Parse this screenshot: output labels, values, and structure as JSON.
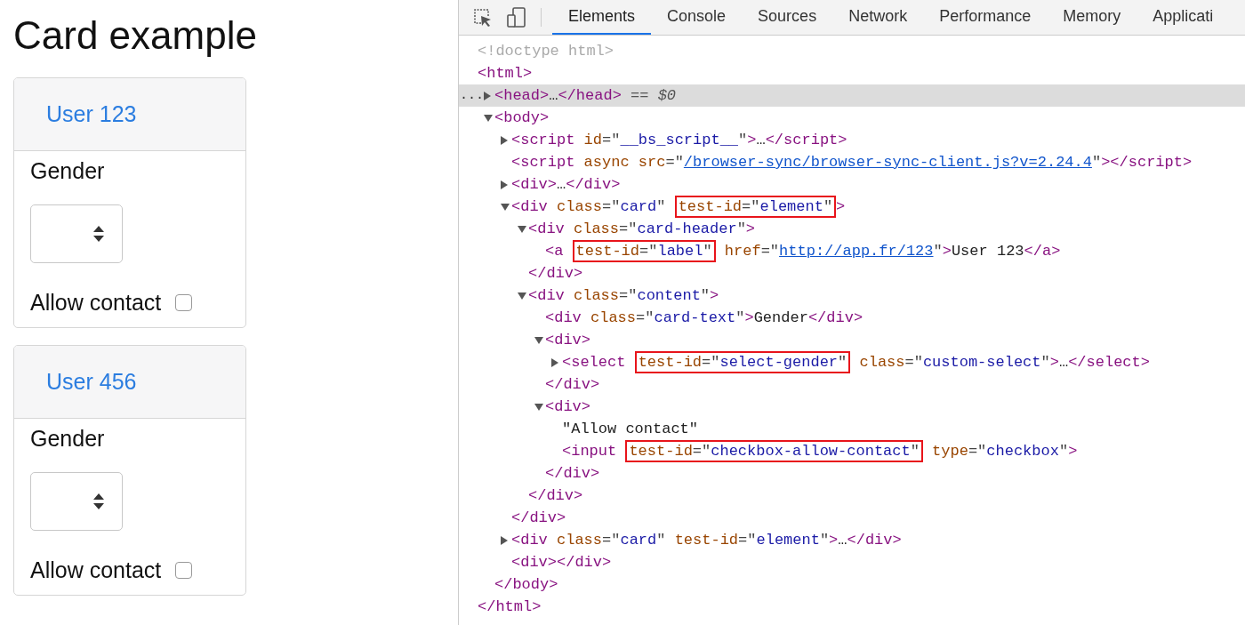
{
  "page": {
    "title": "Card example",
    "cards": [
      {
        "label": "User 123",
        "field_label": "Gender",
        "checkbox_label": "Allow contact",
        "checked": false
      },
      {
        "label": "User 456",
        "field_label": "Gender",
        "checkbox_label": "Allow contact",
        "checked": false
      }
    ]
  },
  "devtools": {
    "tabs": [
      {
        "label": "Elements",
        "selected": true
      },
      {
        "label": "Console",
        "selected": false
      },
      {
        "label": "Sources",
        "selected": false
      },
      {
        "label": "Network",
        "selected": false
      },
      {
        "label": "Performance",
        "selected": false
      },
      {
        "label": "Memory",
        "selected": false
      },
      {
        "label": "Applicati",
        "selected": false
      }
    ],
    "tree": [
      {
        "selected": false,
        "tokens": [
          {
            "kind": "comment",
            "text": "<!doctype html>"
          }
        ]
      },
      {
        "selected": false,
        "tokens": [
          {
            "kind": "tag",
            "text": "<html>"
          }
        ],
        "close": [
          {
            "kind": "tag",
            "text": "</html>"
          }
        ],
        "children": [
          {
            "expanded": false,
            "selected": true,
            "marker": "...",
            "tokens": [
              {
                "kind": "tag",
                "text": "<head>"
              },
              {
                "kind": "text",
                "text": "…"
              },
              {
                "kind": "tag",
                "text": "</head>"
              },
              {
                "kind": "dim",
                "text": " == "
              },
              {
                "kind": "var",
                "text": "$0"
              }
            ]
          },
          {
            "expanded": true,
            "selected": false,
            "tokens": [
              {
                "kind": "tag",
                "text": "<body>"
              }
            ],
            "close": [
              {
                "kind": "tag",
                "text": "</body>"
              }
            ],
            "children": [
              {
                "expanded": false,
                "selected": false,
                "tokens": [
                  {
                    "kind": "tag",
                    "text": "<script"
                  },
                  {
                    "kind": "attr",
                    "text": " id"
                  },
                  {
                    "kind": "punct",
                    "text": "=\""
                  },
                  {
                    "kind": "value",
                    "text": "__bs_script__"
                  },
                  {
                    "kind": "punct",
                    "text": "\""
                  },
                  {
                    "kind": "tag",
                    "text": ">"
                  },
                  {
                    "kind": "text",
                    "text": "…"
                  },
                  {
                    "kind": "tag",
                    "text": "</script>"
                  }
                ]
              },
              {
                "selected": false,
                "tokens": [
                  {
                    "kind": "tag",
                    "text": "<script"
                  },
                  {
                    "kind": "attr",
                    "text": " async src"
                  },
                  {
                    "kind": "punct",
                    "text": "=\""
                  },
                  {
                    "kind": "link",
                    "text": "/browser-sync/browser-sync-client.js?v=2.24.4"
                  },
                  {
                    "kind": "punct",
                    "text": "\""
                  },
                  {
                    "kind": "tag",
                    "text": "></script>"
                  }
                ]
              },
              {
                "expanded": false,
                "selected": false,
                "tokens": [
                  {
                    "kind": "tag",
                    "text": "<div>"
                  },
                  {
                    "kind": "text",
                    "text": "…"
                  },
                  {
                    "kind": "tag",
                    "text": "</div>"
                  }
                ]
              },
              {
                "expanded": true,
                "selected": false,
                "tokens": [
                  {
                    "kind": "tag",
                    "text": "<div"
                  },
                  {
                    "kind": "attr",
                    "text": " class"
                  },
                  {
                    "kind": "punct",
                    "text": "=\""
                  },
                  {
                    "kind": "value",
                    "text": "card"
                  },
                  {
                    "kind": "punct",
                    "text": "\" "
                  },
                  {
                    "kind": "box",
                    "tokens": [
                      {
                        "kind": "attr",
                        "text": "test-id"
                      },
                      {
                        "kind": "punct",
                        "text": "=\""
                      },
                      {
                        "kind": "value",
                        "text": "element"
                      },
                      {
                        "kind": "punct",
                        "text": "\""
                      }
                    ]
                  },
                  {
                    "kind": "tag",
                    "text": ">"
                  }
                ],
                "close": [
                  {
                    "kind": "tag",
                    "text": "</div>"
                  }
                ],
                "children": [
                  {
                    "expanded": true,
                    "selected": false,
                    "tokens": [
                      {
                        "kind": "tag",
                        "text": "<div"
                      },
                      {
                        "kind": "attr",
                        "text": " class"
                      },
                      {
                        "kind": "punct",
                        "text": "=\""
                      },
                      {
                        "kind": "value",
                        "text": "card-header"
                      },
                      {
                        "kind": "punct",
                        "text": "\""
                      },
                      {
                        "kind": "tag",
                        "text": ">"
                      }
                    ],
                    "close": [
                      {
                        "kind": "tag",
                        "text": "</div>"
                      }
                    ],
                    "children": [
                      {
                        "selected": false,
                        "tokens": [
                          {
                            "kind": "tag",
                            "text": "<a "
                          },
                          {
                            "kind": "box",
                            "tokens": [
                              {
                                "kind": "attr",
                                "text": "test-id"
                              },
                              {
                                "kind": "punct",
                                "text": "=\""
                              },
                              {
                                "kind": "value",
                                "text": "label"
                              },
                              {
                                "kind": "punct",
                                "text": "\""
                              }
                            ]
                          },
                          {
                            "kind": "attr",
                            "text": " href"
                          },
                          {
                            "kind": "punct",
                            "text": "=\""
                          },
                          {
                            "kind": "link",
                            "text": "http://app.fr/123"
                          },
                          {
                            "kind": "punct",
                            "text": "\""
                          },
                          {
                            "kind": "tag",
                            "text": ">"
                          },
                          {
                            "kind": "text",
                            "text": "User 123"
                          },
                          {
                            "kind": "tag",
                            "text": "</a>"
                          }
                        ]
                      }
                    ]
                  },
                  {
                    "expanded": true,
                    "selected": false,
                    "tokens": [
                      {
                        "kind": "tag",
                        "text": "<div"
                      },
                      {
                        "kind": "attr",
                        "text": " class"
                      },
                      {
                        "kind": "punct",
                        "text": "=\""
                      },
                      {
                        "kind": "value",
                        "text": "content"
                      },
                      {
                        "kind": "punct",
                        "text": "\""
                      },
                      {
                        "kind": "tag",
                        "text": ">"
                      }
                    ],
                    "close": [
                      {
                        "kind": "tag",
                        "text": "</div>"
                      }
                    ],
                    "children": [
                      {
                        "selected": false,
                        "tokens": [
                          {
                            "kind": "tag",
                            "text": "<div"
                          },
                          {
                            "kind": "attr",
                            "text": " class"
                          },
                          {
                            "kind": "punct",
                            "text": "=\""
                          },
                          {
                            "kind": "value",
                            "text": "card-text"
                          },
                          {
                            "kind": "punct",
                            "text": "\""
                          },
                          {
                            "kind": "tag",
                            "text": ">"
                          },
                          {
                            "kind": "text",
                            "text": "Gender"
                          },
                          {
                            "kind": "tag",
                            "text": "</div>"
                          }
                        ]
                      },
                      {
                        "expanded": true,
                        "selected": false,
                        "tokens": [
                          {
                            "kind": "tag",
                            "text": "<div>"
                          }
                        ],
                        "close": [
                          {
                            "kind": "tag",
                            "text": "</div>"
                          }
                        ],
                        "children": [
                          {
                            "expanded": false,
                            "selected": false,
                            "tokens": [
                              {
                                "kind": "tag",
                                "text": "<select "
                              },
                              {
                                "kind": "box",
                                "tokens": [
                                  {
                                    "kind": "attr",
                                    "text": "test-id"
                                  },
                                  {
                                    "kind": "punct",
                                    "text": "=\""
                                  },
                                  {
                                    "kind": "value",
                                    "text": "select-gender"
                                  },
                                  {
                                    "kind": "punct",
                                    "text": "\""
                                  }
                                ]
                              },
                              {
                                "kind": "attr",
                                "text": " class"
                              },
                              {
                                "kind": "punct",
                                "text": "=\""
                              },
                              {
                                "kind": "value",
                                "text": "custom-select"
                              },
                              {
                                "kind": "punct",
                                "text": "\""
                              },
                              {
                                "kind": "tag",
                                "text": ">"
                              },
                              {
                                "kind": "text",
                                "text": "…"
                              },
                              {
                                "kind": "tag",
                                "text": "</select>"
                              }
                            ]
                          }
                        ]
                      },
                      {
                        "expanded": true,
                        "selected": false,
                        "tokens": [
                          {
                            "kind": "tag",
                            "text": "<div>"
                          }
                        ],
                        "close": [
                          {
                            "kind": "tag",
                            "text": "</div>"
                          }
                        ],
                        "children": [
                          {
                            "selected": false,
                            "tokens": [
                              {
                                "kind": "text",
                                "text": "\"Allow contact\""
                              }
                            ]
                          },
                          {
                            "selected": false,
                            "tokens": [
                              {
                                "kind": "tag",
                                "text": "<input "
                              },
                              {
                                "kind": "box",
                                "tokens": [
                                  {
                                    "kind": "attr",
                                    "text": "test-id"
                                  },
                                  {
                                    "kind": "punct",
                                    "text": "=\""
                                  },
                                  {
                                    "kind": "value",
                                    "text": "checkbox-allow-contact"
                                  },
                                  {
                                    "kind": "punct",
                                    "text": "\""
                                  }
                                ]
                              },
                              {
                                "kind": "attr",
                                "text": " type"
                              },
                              {
                                "kind": "punct",
                                "text": "=\""
                              },
                              {
                                "kind": "value",
                                "text": "checkbox"
                              },
                              {
                                "kind": "punct",
                                "text": "\""
                              },
                              {
                                "kind": "tag",
                                "text": ">"
                              }
                            ]
                          }
                        ]
                      }
                    ]
                  }
                ]
              },
              {
                "expanded": false,
                "selected": false,
                "tokens": [
                  {
                    "kind": "tag",
                    "text": "<div"
                  },
                  {
                    "kind": "attr",
                    "text": " class"
                  },
                  {
                    "kind": "punct",
                    "text": "=\""
                  },
                  {
                    "kind": "value",
                    "text": "card"
                  },
                  {
                    "kind": "punct",
                    "text": "\""
                  },
                  {
                    "kind": "attr",
                    "text": " test-id"
                  },
                  {
                    "kind": "punct",
                    "text": "=\""
                  },
                  {
                    "kind": "value",
                    "text": "element"
                  },
                  {
                    "kind": "punct",
                    "text": "\""
                  },
                  {
                    "kind": "tag",
                    "text": ">"
                  },
                  {
                    "kind": "text",
                    "text": "…"
                  },
                  {
                    "kind": "tag",
                    "text": "</div>"
                  }
                ]
              },
              {
                "selected": false,
                "tokens": [
                  {
                    "kind": "tag",
                    "text": "<div></div>"
                  }
                ]
              }
            ]
          }
        ]
      }
    ]
  }
}
